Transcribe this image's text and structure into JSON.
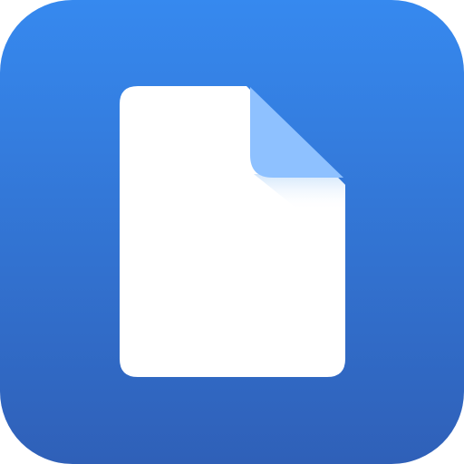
{
  "icon": {
    "name": "document-icon",
    "colors": {
      "background_top": "#3689EF",
      "background_bottom": "#2F60B8",
      "page": "#FFFFFF",
      "fold": "#8EC1FF",
      "fold_shadow": "#D2E6FB"
    }
  }
}
